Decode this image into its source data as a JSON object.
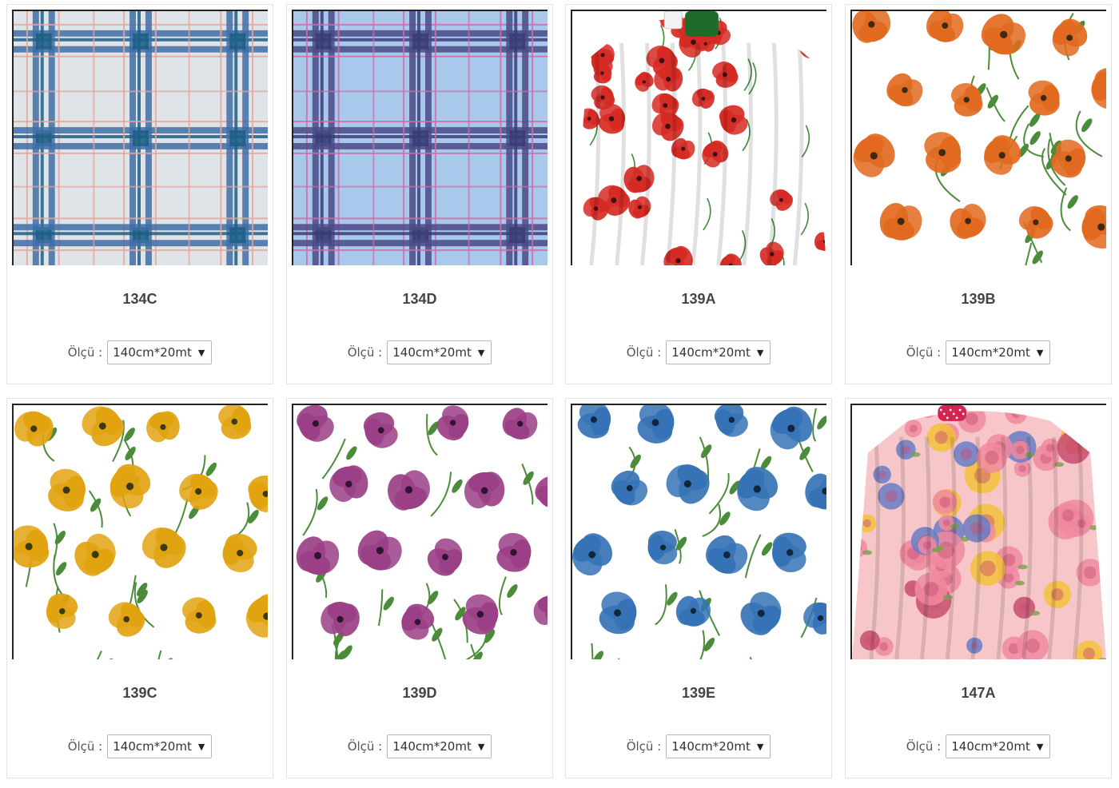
{
  "size_label": "Ölçü :",
  "products": [
    {
      "code": "134C",
      "size": "140cm*20mt",
      "pattern": "plaid",
      "colors": {
        "base": "#dfe4e8",
        "band": "#3f6ea6",
        "accent": "#1e5f86",
        "thin": "#e5a39a"
      }
    },
    {
      "code": "134D",
      "size": "140cm*20mt",
      "pattern": "plaid",
      "colors": {
        "base": "#a9c9ec",
        "band": "#4b4a86",
        "accent": "#3a3d75",
        "thin": "#d26aa8"
      }
    },
    {
      "code": "139A",
      "size": "140cm*20mt",
      "pattern": "tablecloth-poppy",
      "colors": {
        "flower": "#d62a24",
        "center": "#3a1010",
        "stem": "#3d8a3a",
        "base": "#ffffff"
      }
    },
    {
      "code": "139B",
      "size": "140cm*20mt",
      "pattern": "poppy",
      "colors": {
        "flower": "#e26a20",
        "center": "#3e2a12",
        "stem": "#4b8c3a",
        "base": "#ffffff"
      }
    },
    {
      "code": "139C",
      "size": "140cm*20mt",
      "pattern": "poppy",
      "colors": {
        "flower": "#e2a310",
        "center": "#3d3a12",
        "stem": "#4b8c3a",
        "base": "#ffffff"
      }
    },
    {
      "code": "139D",
      "size": "140cm*20mt",
      "pattern": "poppy",
      "colors": {
        "flower": "#9b3f86",
        "center": "#2e1530",
        "stem": "#4b8c3a",
        "base": "#ffffff"
      }
    },
    {
      "code": "139E",
      "size": "140cm*20mt",
      "pattern": "poppy",
      "colors": {
        "flower": "#3673b6",
        "center": "#12273e",
        "stem": "#4b8c3a",
        "base": "#ffffff"
      }
    },
    {
      "code": "147A",
      "size": "140cm*20mt",
      "pattern": "tablecloth-rose",
      "colors": {
        "flower": "#f08aa0",
        "center": "#c84e70",
        "stem": "#7aa04a",
        "base": "#f6c6c8"
      }
    }
  ]
}
